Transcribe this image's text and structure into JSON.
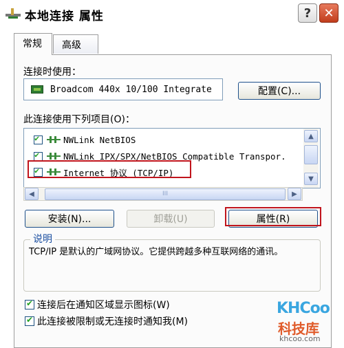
{
  "window": {
    "title": "本地连接 属性",
    "help_label": "?",
    "close_label": "✕"
  },
  "tabs": [
    {
      "label": "常规"
    },
    {
      "label": "高级"
    }
  ],
  "connect_using": {
    "label": "连接时使用：",
    "adapter": "Broadcom 440x 10/100 Integrate",
    "configure_button": "配置(C)..."
  },
  "components": {
    "label": "此连接使用下列项目(O)：",
    "items": [
      {
        "label": "NWLink NetBIOS",
        "checked": true
      },
      {
        "label": "NWLink IPX/SPX/NetBIOS Compatible Transpor.",
        "checked": true
      },
      {
        "label": "Internet 协议 (TCP/IP)",
        "checked": true
      }
    ],
    "hscroll_grip": "III"
  },
  "buttons": {
    "install": "安装(N)...",
    "uninstall": "卸载(U)",
    "properties": "属性(R)"
  },
  "description": {
    "title": "说明",
    "text": "TCP/IP 是默认的广域网协议。它提供跨越多种互联网络的通讯。"
  },
  "options": [
    {
      "label": "连接后在通知区域显示图标(W)",
      "checked": true
    },
    {
      "label": "此连接被限制或无连接时通知我(M)",
      "checked": true
    }
  ],
  "watermark": {
    "logo": "KHCoo",
    "name": "科技库",
    "url": "khcoo.com"
  },
  "colors": {
    "highlight": "#c0141c",
    "button_border": "#1c4f8a",
    "close_button": "#c13d1c"
  }
}
